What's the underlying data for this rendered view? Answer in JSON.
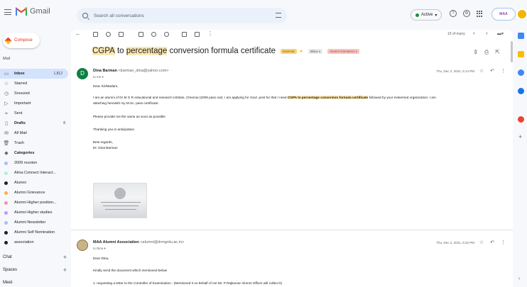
{
  "app": {
    "name": "Gmail"
  },
  "search": {
    "placeholder": "Search all conversations"
  },
  "status": {
    "label": "Active"
  },
  "compose": {
    "label": "Compose"
  },
  "sidebar": {
    "mail_label": "Mail",
    "items": [
      {
        "label": "Inbox",
        "count": "1,812",
        "icon": "inbox-icon",
        "bold": true
      },
      {
        "label": "Starred",
        "count": "",
        "icon": "star-icon"
      },
      {
        "label": "Snoozed",
        "count": "",
        "icon": "clock-icon"
      },
      {
        "label": "Important",
        "count": "",
        "icon": "important-icon"
      },
      {
        "label": "Sent",
        "count": "",
        "icon": "send-icon"
      },
      {
        "label": "Drafts",
        "count": "8",
        "icon": "draft-icon",
        "bold": true
      },
      {
        "label": "All Mail",
        "count": "",
        "icon": "mail-icon"
      },
      {
        "label": "Trash",
        "count": "",
        "icon": "trash-icon"
      },
      {
        "label": "Categories",
        "count": "",
        "icon": "label-icon",
        "bold": true
      }
    ],
    "labels": [
      {
        "label": "2009 reunion",
        "color": "#a4bdfc"
      },
      {
        "label": "Alma Connect Interact...",
        "color": "#b3efd3"
      },
      {
        "label": "Alumni",
        "color": "#202124"
      },
      {
        "label": "Alumni Grievance",
        "color": "#ffad47"
      },
      {
        "label": "Alumni Higher position...",
        "color": "#f691b2"
      },
      {
        "label": "Alumni Higher studies",
        "color": "#b99aff"
      },
      {
        "label": "Alumni Newsletter",
        "color": "#a4bdfc"
      },
      {
        "label": "Alumni Self Nomination",
        "color": "#202124"
      },
      {
        "label": "association",
        "color": "#202124"
      }
    ],
    "chat_label": "Chat",
    "spaces_label": "Spaces",
    "meet_label": "Meet"
  },
  "toolbar": {
    "pager": "19 of many"
  },
  "thread": {
    "subject_parts": [
      "CGPA",
      " to ",
      "percentage",
      " conversion formula certificate"
    ],
    "tags": [
      "External",
      "Inbox x",
      "Alumni Grievance x"
    ]
  },
  "messages": [
    {
      "avatar_letter": "D",
      "avatar_color": "#0b8043",
      "sender_name": "Dina Barman",
      "sender_email": "<barman_dina@yahoo.com>",
      "to": "to me ▾",
      "date": "Thu, Dec 2, 2021, 5:14 PM",
      "body": {
        "greeting": "Dear Sir/Madam,",
        "line1_a": "I am an alumni of Dr M G R educational and research institute, Chennai (2009 pass out). I am applying for Govt. post for that I need ",
        "line1_b": "CGPA to percentage conversion formula certificate",
        "line1_c": " followed by your esteemed organization. I am",
        "line2": "attaching herewith my M.Sc. pass certificate.",
        "line3": "Please provide me the same as soon as possible",
        "line4": "Thanking you in anticipation",
        "regards": "Best regards,",
        "sign": "Dr. Dina Barman"
      }
    },
    {
      "avatar_letter": "",
      "avatar_color": "#c9b48a",
      "sender_name": "MAA Alumni Association",
      "sender_email": "<alumni@drmgrdu.ac.in>",
      "to": "to Dina ▾",
      "date": "Thu, Dec 2, 2021, 5:32 PM",
      "body": {
        "greeting": "Dear Dina,",
        "line1": "Kindly send the document which mentioned below",
        "line2": "1. requesting a letter to the Controller of Examination   - (Mentioned it on behalf of me Mr. P Rajkumar Alumni Officer will collect it)"
      }
    }
  ]
}
